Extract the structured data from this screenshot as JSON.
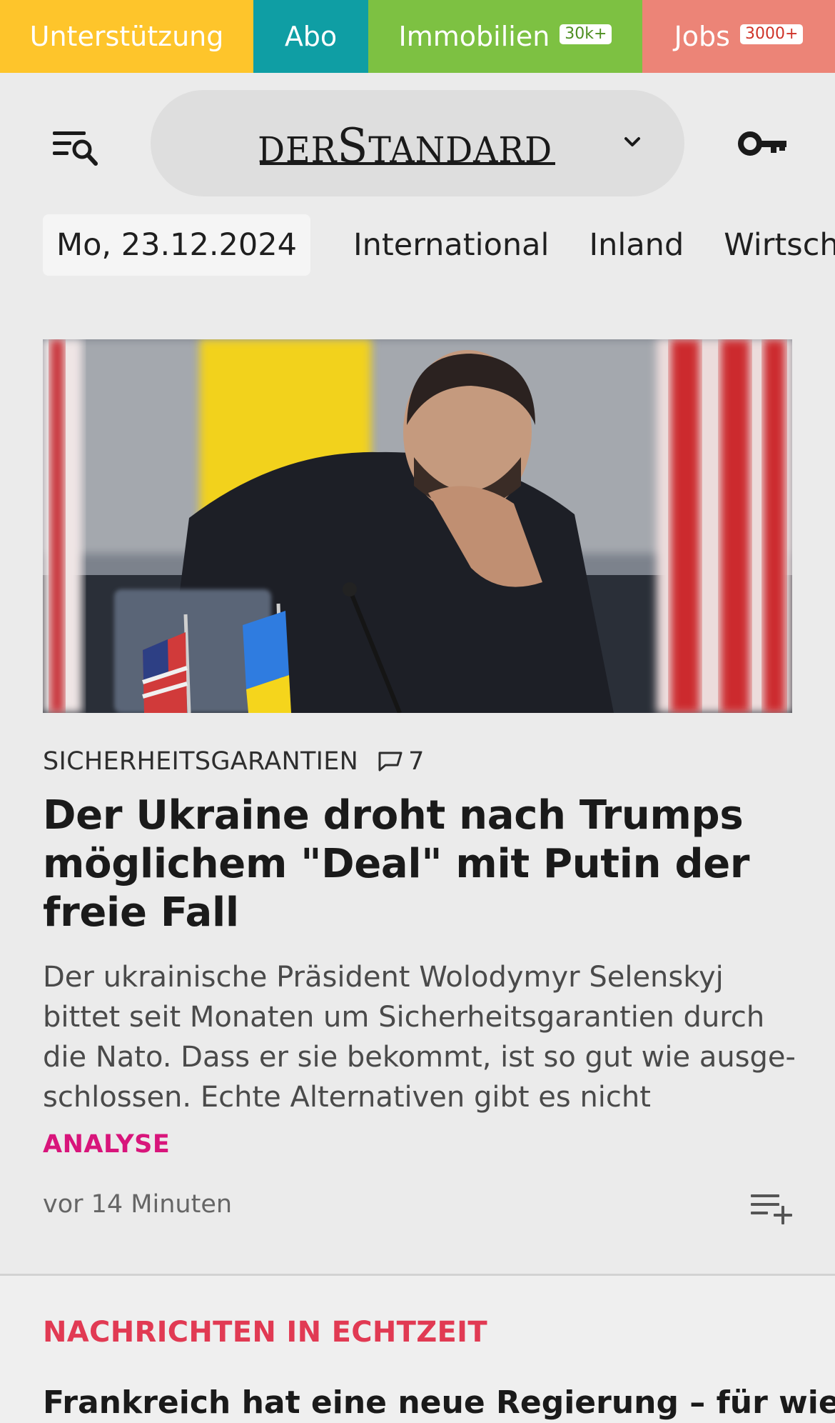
{
  "topbar": {
    "support": "Unterstützung",
    "abo": "Abo",
    "immobilien": "Immobilien",
    "immobilien_badge": "30k+",
    "jobs": "Jobs",
    "jobs_badge": "3000+",
    "colors": {
      "support": "#fec52b",
      "abo": "#0f9ea4",
      "immobilien": "#7dc142",
      "jobs": "#ec8477"
    }
  },
  "header": {
    "logo_der": "DER",
    "logo_s": "S",
    "logo_tandar": "TANDAR",
    "logo_d": "D",
    "menu_icon": "menu-search-icon",
    "chevron_icon": "chevron-down-icon",
    "login_icon": "key-icon"
  },
  "date": "Mo, 23.12.2024",
  "nav": {
    "items": [
      "International",
      "Inland",
      "Wirtschaft"
    ]
  },
  "article": {
    "kicker": "SICHERHEITSGARANTIEN",
    "comment_icon": "comment-icon",
    "comment_count": "7",
    "headline": "Der Ukraine droht nach Trumps möglichem \"Deal\" mit Putin der freie Fall",
    "teaser_lines": [
      "Der ukrainische Präsident Wolodymyr Selenskyj",
      "bittet seit Monaten um Sicherheitsgarantien durch",
      "die Nato. Dass er sie bekommt, ist so gut wie ausge-",
      "schlossen. Echte Alternativen gibt es nicht"
    ],
    "genre": "ANALYSE",
    "genre_color": "#d8157b",
    "time": "vor 14 Minuten",
    "add_icon": "add-to-list-icon"
  },
  "live": {
    "title": "NACHRICHTEN IN ECHTZEIT",
    "title_color": "#e13a53",
    "headline": "Frankreich hat eine neue Regierung – für wie"
  }
}
